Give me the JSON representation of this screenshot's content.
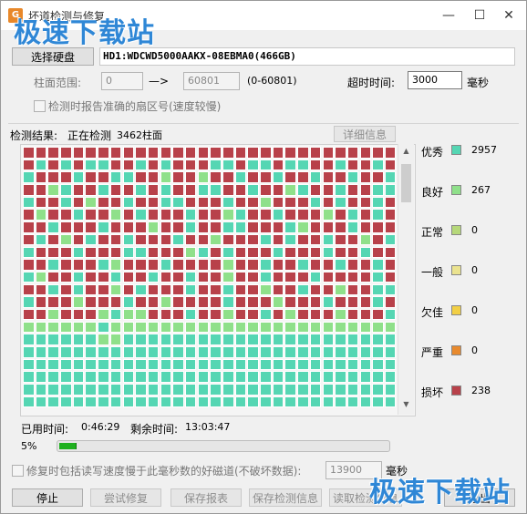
{
  "window": {
    "title": "坏道检测与修复"
  },
  "watermark": {
    "text": "极速下载站"
  },
  "select_disk_button": "选择硬盘",
  "disk_name": "HD1:WDCWD5000AAKX-08EBMA0(466GB)",
  "cylinder": {
    "label": "柱面范围:",
    "start": "0",
    "arrow": "—>",
    "end": "60801",
    "range": "(0-60801)"
  },
  "timeout": {
    "label": "超时时间:",
    "value": "3000",
    "unit": "毫秒"
  },
  "precise_sector_checkbox": {
    "label": "检测时报告准确的扇区号(速度较慢)",
    "checked": false
  },
  "result": {
    "label": "检测结果:",
    "status": "正在检测",
    "count": "3462柱面"
  },
  "detail_button": "详细信息",
  "legend": [
    {
      "name": "优秀",
      "color": "#55d6b3",
      "count": "2957"
    },
    {
      "name": "良好",
      "color": "#8fe08a",
      "count": "267"
    },
    {
      "name": "正常",
      "color": "#b6d87a",
      "count": "0"
    },
    {
      "name": "一般",
      "color": "#ebe38f",
      "count": "0"
    },
    {
      "name": "欠佳",
      "color": "#f2cf45",
      "count": "0"
    },
    {
      "name": "严重",
      "color": "#e88a2e",
      "count": "0"
    },
    {
      "name": "损坏",
      "color": "#b8414a",
      "count": "238"
    }
  ],
  "elapsed": {
    "label": "已用时间:",
    "value": "0:46:29"
  },
  "remaining": {
    "label": "剩余时间:",
    "value": "13:03:47"
  },
  "progress": {
    "percent_text": "5%",
    "fraction": 0.05
  },
  "repair_checkbox": {
    "label": "修复时包括读写速度慢于此毫秒数的好磁道(不破坏数据):",
    "checked": false,
    "value": "13900",
    "unit": "毫秒"
  },
  "bottom_buttons": {
    "stop": "停止",
    "try_repair": "尝试修复",
    "save_report": "保存报表",
    "save_info": "保存检测信息",
    "read_info": "读取检测信息",
    "exit": "退出"
  },
  "grid_rows": [
    "RRRRRRRRRRRRRRRRRRRRRRRRRRRRRR",
    "RTRTRTTRRTRTRRRTTRTTRTTRRTRRTR",
    "TRRRTRRTTRRGRRGRRTRRTRRTRRTRRT",
    "RRGTRRTRRTRTRRTTRRTRRGTRRTRRTT",
    "TRRTRGRRTRRTTRRRTRRGRRRTRTRRTR",
    "RGRRTRRGRTRRRTRRGTRRTRRRGRTRTR",
    "RRTRRRTRRRGRRTRRTTRRRTGRRRTRRR",
    "RTRGRTRRTRRRTRRGRRRTRTRRTRRGRT",
    "TRRRTRRRTTRRRGTRTRRRTRRRTRRTRR",
    "RRTRRRTGRRRTRRRRGRRTRRTRRTRRTR",
    "TGRRTRRTRRTRRTRRGRRTRRRTRRRRTR",
    "RRTRTRRGRTRRRTRRTRRGRRTRRGRRTT",
    "TRRRGRRRTRRGRRRRTRRRGRRRTRRRTR",
    "RRGRRRGTGGRRRTRRGRRTRGRRRGRRRT",
    "GGGGGGTGGGGGGGGGGGGGGGGGGGGGGG",
    "TTTTTTGGTTTTTTTTTTTTTTTTTTTTTT",
    "TTTTTTTTTTTTTTTTTTTTTTTTTTTTTT",
    "TTTTTTTTTTTTTTTTTTTTTTTTTTTTTT",
    "TTTTTTTTTTTTTTTTTTTTTTTTTTTTTT",
    "TTTTTTTTTTTTTTTTTTTTTTTTTTTTTT",
    "TTTTTTTTTTTTTTTTTTTTTTTTTTTTTT"
  ]
}
